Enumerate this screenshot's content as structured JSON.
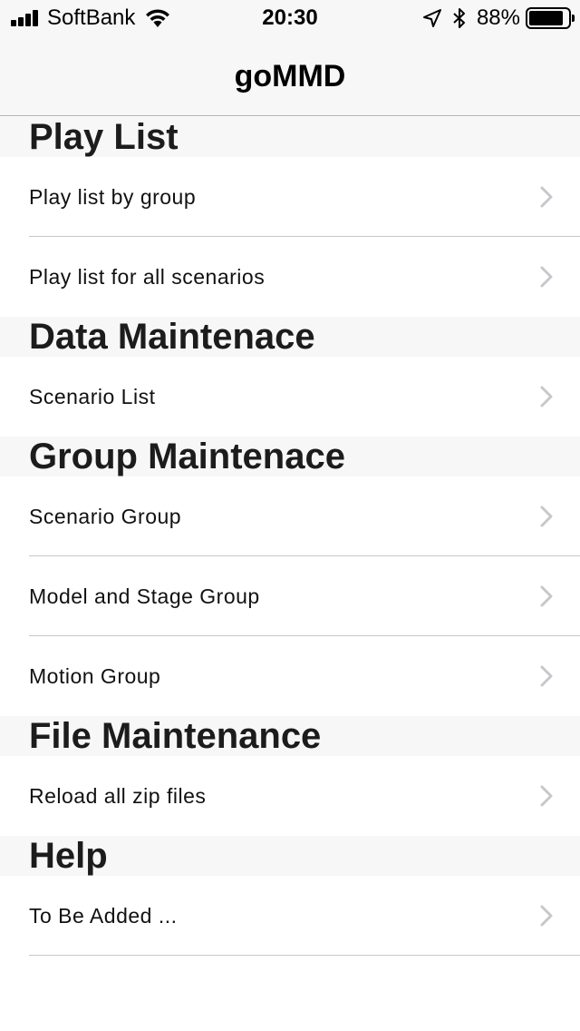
{
  "status_bar": {
    "carrier": "SoftBank",
    "time": "20:30",
    "battery_percent": "88%",
    "battery_level": 0.88,
    "icons": [
      "signal-icon",
      "wifi-icon",
      "location-icon",
      "bluetooth-icon",
      "battery-icon"
    ]
  },
  "nav": {
    "title": "goMMD"
  },
  "sections": [
    {
      "title": "Play List",
      "rows": [
        "Play list by group",
        "Play list for all scenarios"
      ]
    },
    {
      "title": "Data Maintenace",
      "rows": [
        "Scenario List"
      ]
    },
    {
      "title": "Group Maintenace",
      "rows": [
        "Scenario Group",
        "Model and Stage Group",
        "Motion Group"
      ]
    },
    {
      "title": "File Maintenance",
      "rows": [
        "Reload all zip files"
      ]
    },
    {
      "title": "Help",
      "rows": [
        "To Be Added ..."
      ]
    }
  ],
  "colors": {
    "background": "#ffffff",
    "bar_background": "#f7f7f7",
    "separator": "#c8c7cc",
    "chevron": "#c7c7cc"
  }
}
